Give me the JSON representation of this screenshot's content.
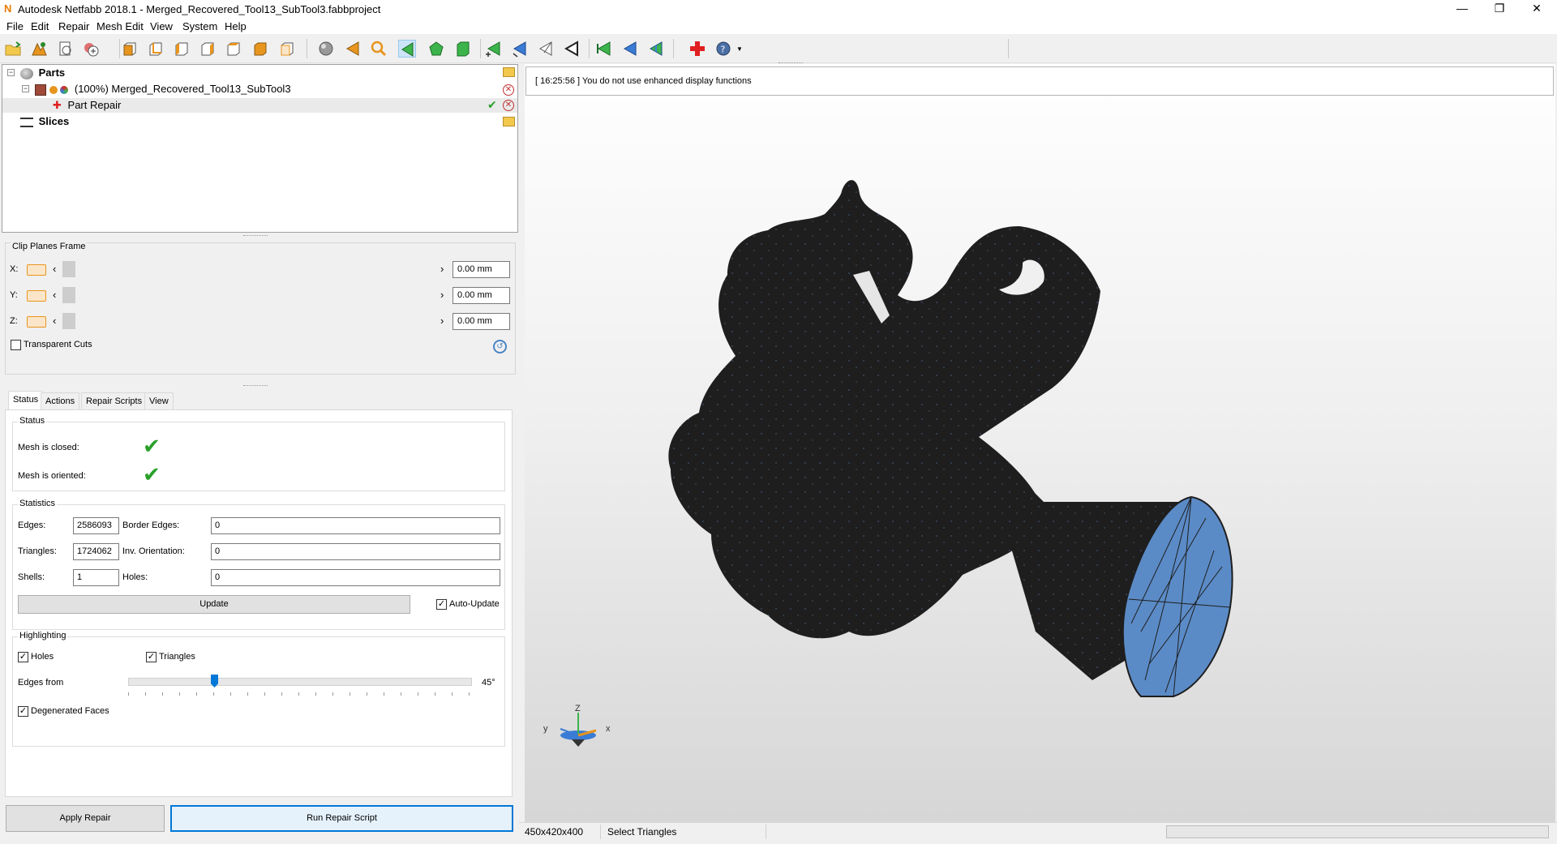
{
  "window": {
    "title": "Autodesk Netfabb 2018.1 - Merged_Recovered_Tool13_SubTool3.fabbproject",
    "minimize": "—",
    "restore": "❐",
    "close": "✕"
  },
  "menu": [
    "File",
    "Edit",
    "Repair",
    "Mesh Edit",
    "View",
    "System",
    "Help"
  ],
  "tree": {
    "parts_label": "Parts",
    "part_name": "(100%) Merged_Recovered_Tool13_SubTool3",
    "repair_label": "Part Repair",
    "slices_label": "Slices"
  },
  "clip_planes": {
    "title": "Clip Planes Frame",
    "rows": [
      {
        "axis": "X:",
        "value": "0.00 mm"
      },
      {
        "axis": "Y:",
        "value": "0.00 mm"
      },
      {
        "axis": "Z:",
        "value": "0.00 mm"
      }
    ],
    "transparent_cuts_label": "Transparent Cuts",
    "transparent_cuts_checked": false
  },
  "tabs": [
    "Status",
    "Actions",
    "Repair Scripts",
    "View"
  ],
  "status_group": {
    "title": "Status",
    "closed_label": "Mesh is closed:",
    "oriented_label": "Mesh is oriented:"
  },
  "statistics": {
    "title": "Statistics",
    "edges_label": "Edges:",
    "edges_value": "2586093",
    "border_edges_label": "Border Edges:",
    "border_edges_value": "0",
    "triangles_label": "Triangles:",
    "triangles_value": "1724062",
    "inv_orientation_label": "Inv. Orientation:",
    "inv_orientation_value": "0",
    "shells_label": "Shells:",
    "shells_value": "1",
    "holes_label": "Holes:",
    "holes_value": "0",
    "update_label": "Update",
    "auto_update_label": "Auto-Update",
    "auto_update_checked": true
  },
  "highlighting": {
    "title": "Highlighting",
    "holes_label": "Holes",
    "holes_checked": true,
    "triangles_label": "Triangles",
    "triangles_checked": true,
    "edges_from_label": "Edges from",
    "edges_from_value": "45°",
    "edges_from_fraction": 0.25,
    "degenerated_label": "Degenerated Faces",
    "degenerated_checked": true
  },
  "buttons": {
    "apply_repair": "Apply Repair",
    "run_repair_script": "Run Repair Script"
  },
  "log": {
    "message": "[ 16:25:56 ] You do not use enhanced display functions"
  },
  "axes": {
    "z": "Z",
    "y": "y",
    "x": "x"
  },
  "statusbar": {
    "dimensions": "450x420x400",
    "mode": "Select Triangles"
  },
  "colors": {
    "mesh": "#1e1e1e",
    "cut_face": "#5b8bc7",
    "check": "#2aa02a",
    "selection": "#0078d7"
  }
}
